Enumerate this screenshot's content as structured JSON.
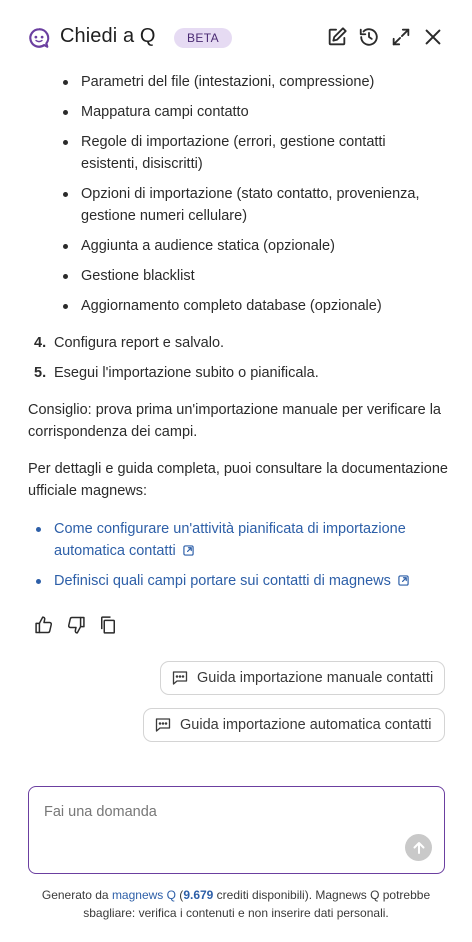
{
  "header": {
    "title": "Chiedi a Q",
    "badge": "BETA",
    "icons": [
      "q-logo-icon",
      "new-chat-icon",
      "history-icon",
      "expand-icon",
      "close-icon"
    ]
  },
  "content": {
    "sub_items": [
      "Parametri del file (intestazioni, compressione)",
      "Mappatura campi contatto",
      "Regole di importazione (errori, gestione contatti esistenti, disiscritti)",
      "Opzioni di importazione (stato contatto, provenienza, gestione numeri cellulare)",
      "Aggiunta a audience statica (opzionale)",
      "Gestione blacklist",
      "Aggiornamento completo database (opzionale)"
    ],
    "steps": [
      {
        "num": "4.",
        "text": "Configura report e salvalo."
      },
      {
        "num": "5.",
        "text": "Esegui l'importazione subito o pianificala."
      }
    ],
    "tip": "Consiglio: prova prima un'importazione manuale per verificare la corrispondenza dei campi.",
    "docs_intro": "Per dettagli e guida completa, puoi consultare la documentazione ufficiale magnews:",
    "links": [
      "Come configurare un'attività pianificata di importazione automatica contatti",
      "Definisci quali campi portare sui contatti di magnews"
    ]
  },
  "feedback": {
    "icons": [
      "thumbs-up-icon",
      "thumbs-down-icon",
      "copy-icon"
    ]
  },
  "suggestions": [
    "Guida importazione manuale contatti",
    "Guida importazione automatica contatti"
  ],
  "input": {
    "placeholder": "Fai una domanda"
  },
  "footer": {
    "prefix": "Generato da ",
    "brand": "magnews Q",
    "open": " (",
    "credits": "9.679",
    "suffix": " crediti disponibili). Magnews Q potrebbe sbagliare: verifica i contenuti e non inserire dati personali."
  },
  "colors": {
    "accent": "#6b3fa0",
    "badge_bg": "#e6dbf3",
    "link": "#2d5fa8",
    "send_disabled": "#c9c9c9"
  }
}
